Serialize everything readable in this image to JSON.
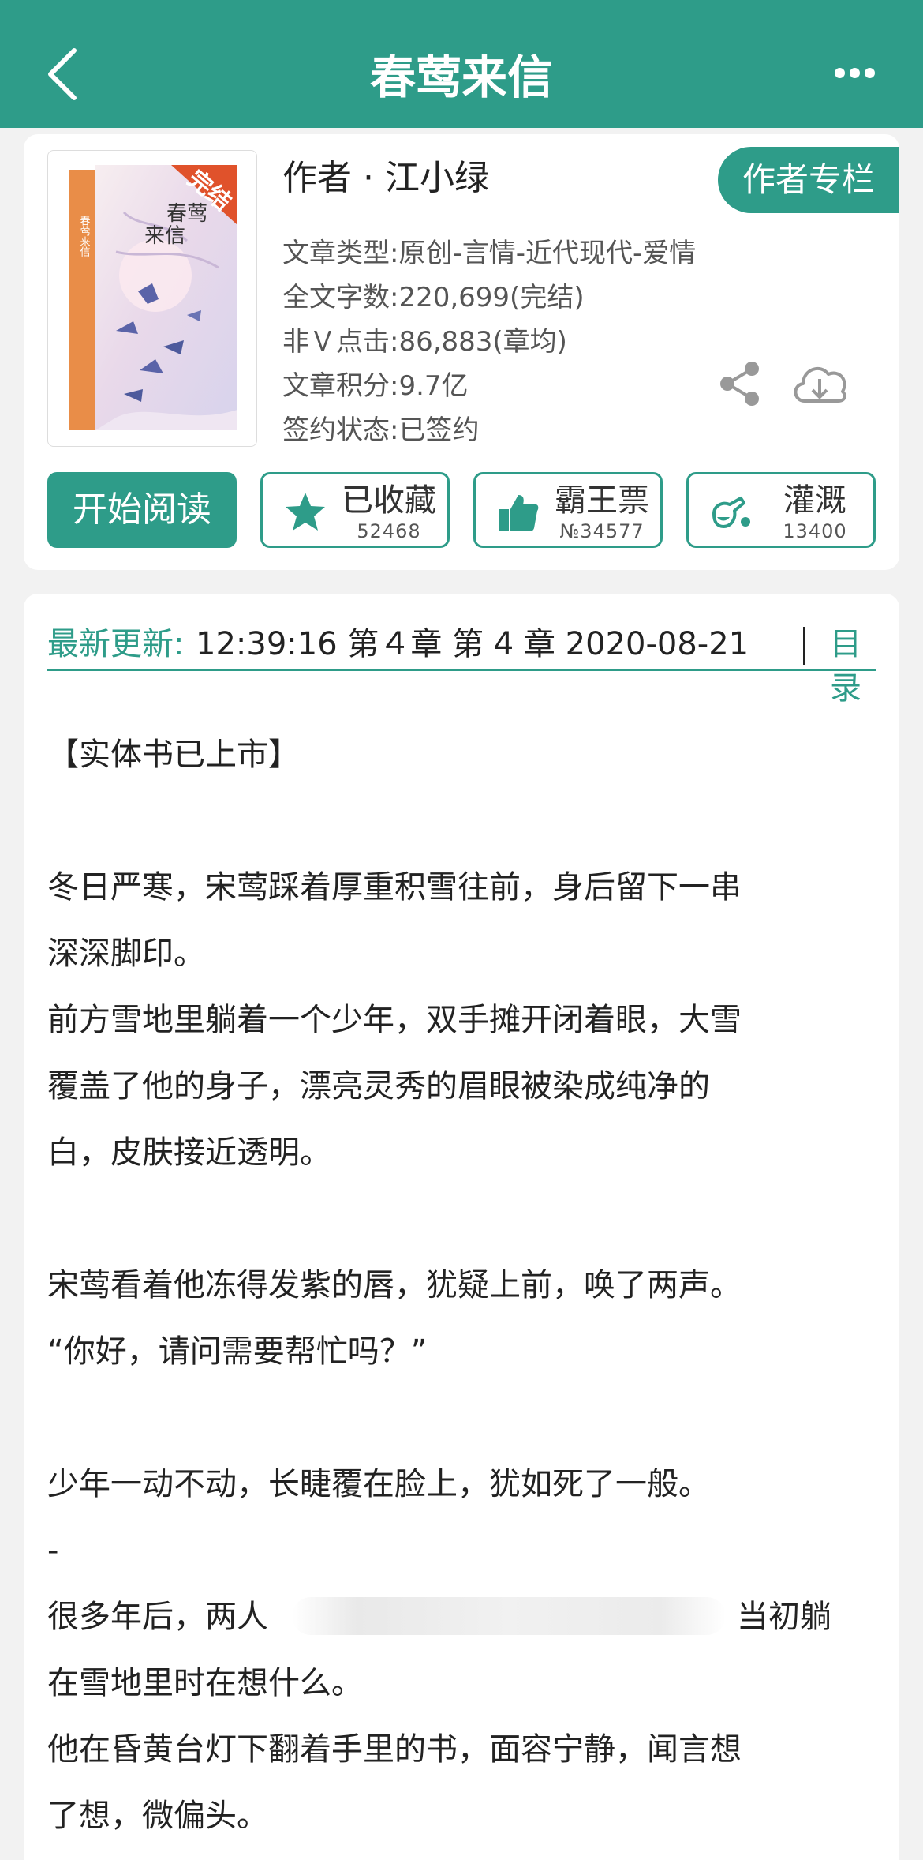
{
  "nav": {
    "title": "春莺来信"
  },
  "book": {
    "cover_badge": "完结",
    "cover_title_lines": [
      "春莺",
      "来信"
    ],
    "spine_title": "春莺来信",
    "author_line": "作者 · 江小绿",
    "author_column_label": "作者专栏",
    "meta": [
      "文章类型:原创-言情-近代现代-爱情",
      "全文字数:220,699(完结)",
      "非Ｖ点击:86,883(章均)",
      "文章积分:9.7亿",
      "签约状态:已签约"
    ]
  },
  "actions": {
    "read_label": "开始阅读",
    "favorite": {
      "label": "已收藏",
      "count": "52468"
    },
    "vote": {
      "label": "霸王票",
      "count": "№34577"
    },
    "water": {
      "label": "灌溉",
      "count": "13400"
    }
  },
  "update": {
    "label": "最新更新:",
    "text": "12:39:16   第４章  第 4 章  2020-08-21",
    "toc_label": "目录"
  },
  "synopsis": [
    "【实体书已上市】",
    "冬日严寒，宋莺踩着厚重积雪往前，身后留下一串",
    "深深脚印。",
    "前方雪地里躺着一个少年，双手摊开闭着眼，大雪",
    "覆盖了他的身子，漂亮灵秀的眉眼被染成纯净的",
    "白，皮肤接近透明。",
    "宋莺看着他冻得发紫的唇，犹疑上前，唤了两声。",
    "“你好，请问需要帮忙吗？”",
    "少年一动不动，长睫覆在脸上，犹如死了一般。",
    "-",
    "很多年后，两人",
    "当初躺",
    "在雪地里时在想什么。",
    "他在昏黄台灯下翻着手里的书，面容宁静，闻言想",
    "了想，微偏头。"
  ],
  "colors": {
    "brand": "#2e9c89",
    "text": "#222222",
    "meta_text": "#555555",
    "page_bg": "#f2f2f2"
  }
}
